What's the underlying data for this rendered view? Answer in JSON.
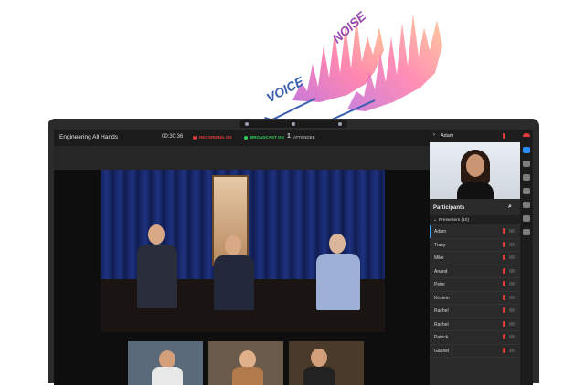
{
  "graphic": {
    "voice_label": "VOICE",
    "noise_label": "NOISE"
  },
  "meeting": {
    "title": "Engineering All Hands",
    "timer": "00:30:36",
    "recording_label": "RECORDING ON",
    "broadcast_label": "BROADCAST ON",
    "attendee_count": "1",
    "attendee_label": "ATTENDEE"
  },
  "panel": {
    "active_speaker": "Adam",
    "participants_title": "Participants",
    "presenters_label": "Presenters (10)",
    "participants": [
      {
        "name": "Adam"
      },
      {
        "name": "Tracy"
      },
      {
        "name": "Mike"
      },
      {
        "name": "Anand"
      },
      {
        "name": "Peter"
      },
      {
        "name": "Kirstein"
      },
      {
        "name": "Rachel"
      },
      {
        "name": "Rachel"
      },
      {
        "name": "Patrick"
      },
      {
        "name": "Gabriel"
      }
    ]
  },
  "colors": {
    "recording": "#e23b3b",
    "broadcast": "#2fd15a",
    "accent": "#2f8cff"
  }
}
